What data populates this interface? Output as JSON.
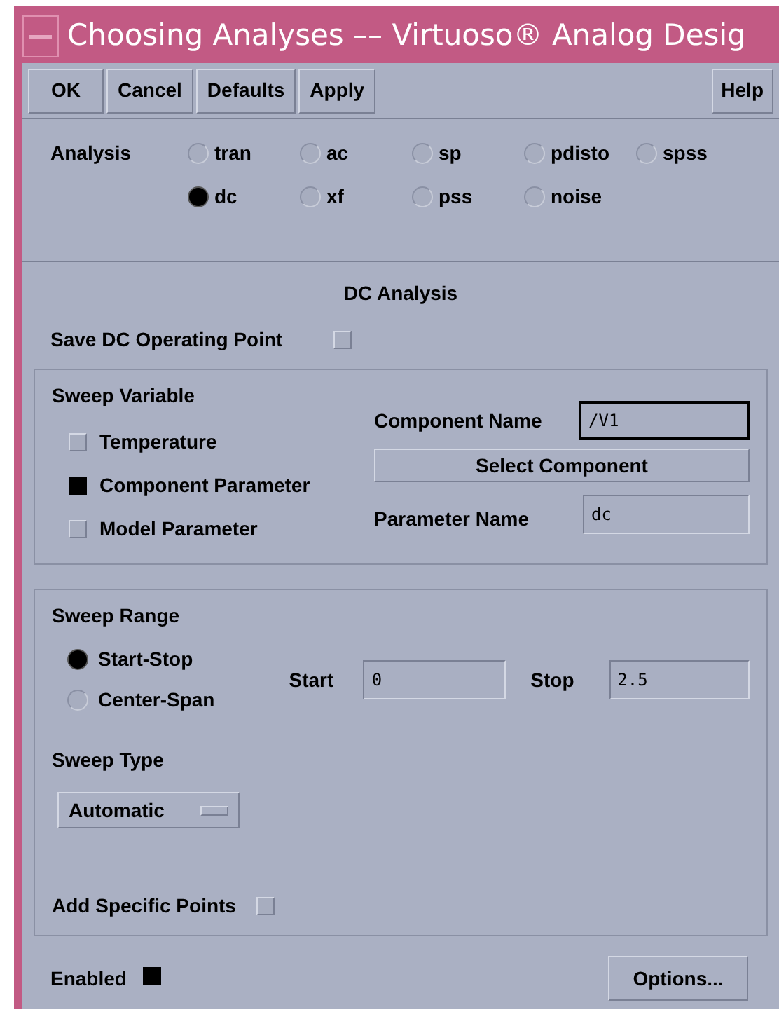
{
  "window": {
    "title": "Choosing Analyses –– Virtuoso® Analog Desig"
  },
  "buttons": [
    {
      "label": "OK"
    },
    {
      "label": "Cancel"
    },
    {
      "label": "Defaults"
    },
    {
      "label": "Apply"
    }
  ],
  "help_button": "Help",
  "analysis": {
    "label": "Analysis",
    "options": [
      {
        "label": "tran",
        "selected": false
      },
      {
        "label": "ac",
        "selected": false
      },
      {
        "label": "sp",
        "selected": false
      },
      {
        "label": "pdisto",
        "selected": false
      },
      {
        "label": "spss",
        "selected": false
      },
      {
        "label": "dc",
        "selected": true
      },
      {
        "label": "xf",
        "selected": false
      },
      {
        "label": "pss",
        "selected": false
      },
      {
        "label": "noise",
        "selected": false
      }
    ]
  },
  "dc_analysis": {
    "title": "DC Analysis",
    "save_dc_operating_point": {
      "label": "Save DC Operating Point",
      "checked": false
    }
  },
  "sweep_variable": {
    "title": "Sweep Variable",
    "options": [
      {
        "label": "Temperature",
        "checked": false
      },
      {
        "label": "Component Parameter",
        "checked": true
      },
      {
        "label": "Model Parameter",
        "checked": false
      }
    ],
    "component_name": {
      "label": "Component Name",
      "value": "/V1"
    },
    "select_button": "Select Component",
    "parameter_name": {
      "label": "Parameter Name",
      "value": "dc"
    }
  },
  "sweep_range": {
    "title": "Sweep Range",
    "modes": [
      {
        "label": "Start-Stop",
        "selected": true
      },
      {
        "label": "Center-Span",
        "selected": false
      }
    ],
    "start": {
      "label": "Start",
      "value": "0"
    },
    "stop": {
      "label": "Stop",
      "value": "2.5"
    },
    "sweep_type": {
      "title": "Sweep Type",
      "value": "Automatic"
    },
    "add_specific_points": {
      "label": "Add Specific Points",
      "checked": false
    }
  },
  "enabled": {
    "label": "Enabled",
    "checked": true
  },
  "options_button": "Options..."
}
